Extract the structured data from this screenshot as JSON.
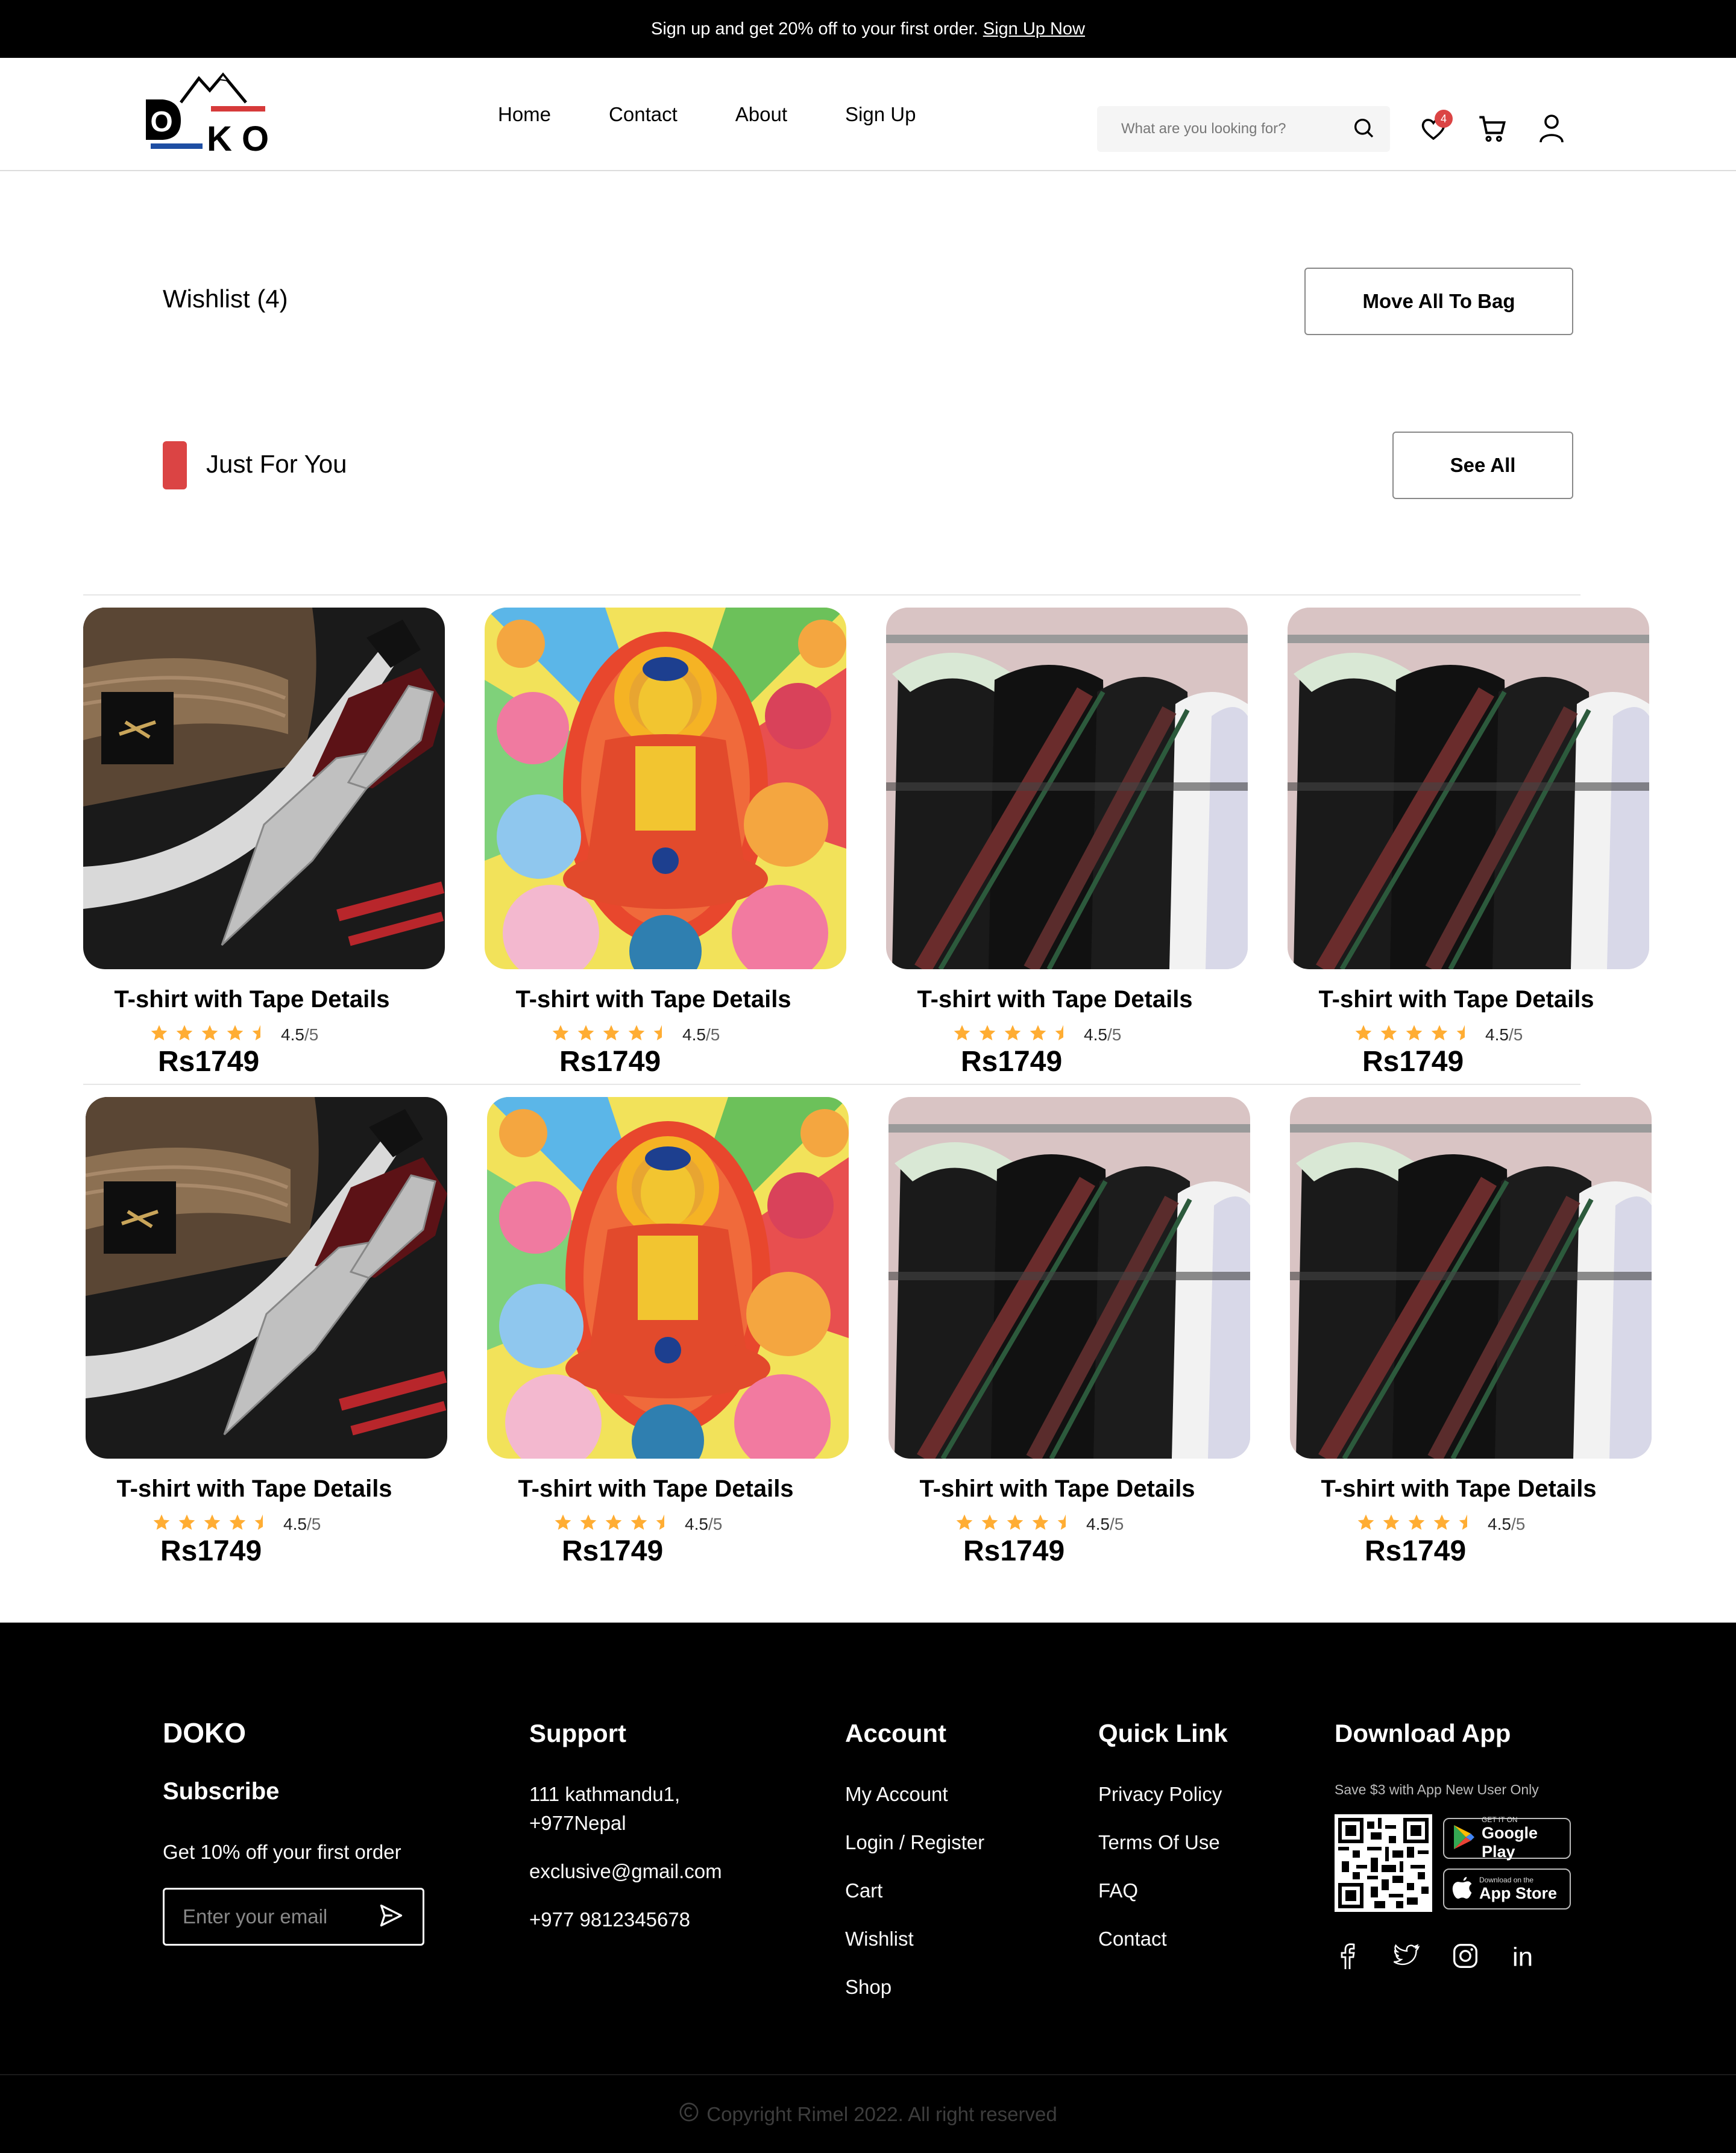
{
  "banner": {
    "text": "Sign up and get 20% off to your first order.",
    "link": "Sign Up Now"
  },
  "logo": {
    "text_top": "D",
    "text_bottom": "KO",
    "alt": "DOKO"
  },
  "nav": [
    "Home",
    "Contact",
    "About",
    "Sign Up"
  ],
  "search": {
    "placeholder": "What are you looking for?"
  },
  "header_icons": {
    "wishlist_count": "4"
  },
  "wishlist": {
    "title": "Wishlist (4)",
    "move_button": "Move All To Bag"
  },
  "just_for_you": {
    "title": "Just For You",
    "see_all": "See All"
  },
  "products": [
    {
      "name": "T-shirt with Tape Details",
      "rating": "4.5",
      "max": "/5",
      "price": "Rs1749",
      "image": "khukuri-hat"
    },
    {
      "name": "T-shirt with Tape Details",
      "rating": "4.5",
      "max": "/5",
      "price": "Rs1749",
      "image": "buddha-thangka"
    },
    {
      "name": "T-shirt with Tape Details",
      "rating": "4.5",
      "max": "/5",
      "price": "Rs1749",
      "image": "shirts-rack"
    },
    {
      "name": "T-shirt with Tape Details",
      "rating": "4.5",
      "max": "/5",
      "price": "Rs1749",
      "image": "shirts-rack"
    },
    {
      "name": "T-shirt with Tape Details",
      "rating": "4.5",
      "max": "/5",
      "price": "Rs1749",
      "image": "khukuri-hat"
    },
    {
      "name": "T-shirt with Tape Details",
      "rating": "4.5",
      "max": "/5",
      "price": "Rs1749",
      "image": "buddha-thangka"
    },
    {
      "name": "T-shirt with Tape Details",
      "rating": "4.5",
      "max": "/5",
      "price": "Rs1749",
      "image": "shirts-rack"
    },
    {
      "name": "T-shirt with Tape Details",
      "rating": "4.5",
      "max": "/5",
      "price": "Rs1749",
      "image": "shirts-rack"
    }
  ],
  "footer": {
    "brand": "DOKO",
    "subscribe": "Subscribe",
    "offer": "Get 10% off your first order",
    "email_placeholder": "Enter your email",
    "support": {
      "title": "Support",
      "address_1": "111 kathmandu1,",
      "address_2": "+977Nepal",
      "email": "exclusive@gmail.com",
      "phone": "+977 9812345678"
    },
    "account": {
      "title": "Account",
      "links": [
        "My Account",
        "Login / Register",
        "Cart",
        "Wishlist",
        "Shop"
      ]
    },
    "quick_link": {
      "title": "Quick Link",
      "links": [
        "Privacy Policy",
        "Terms Of Use",
        "FAQ",
        "Contact"
      ]
    },
    "download": {
      "title": "Download App",
      "promo": "Save $3 with App New User Only",
      "google_small": "GET IT ON",
      "google_big": "Google Play",
      "apple_small": "Download on the",
      "apple_big": "App Store"
    },
    "social_icons": [
      "facebook-icon",
      "twitter-icon",
      "instagram-icon",
      "linkedin-icon"
    ],
    "copyright": "Copyright Rimel 2022. All right reserved"
  },
  "colors": {
    "accent": "#db4444",
    "star": "#ffad33",
    "footer_bg": "#000000"
  }
}
